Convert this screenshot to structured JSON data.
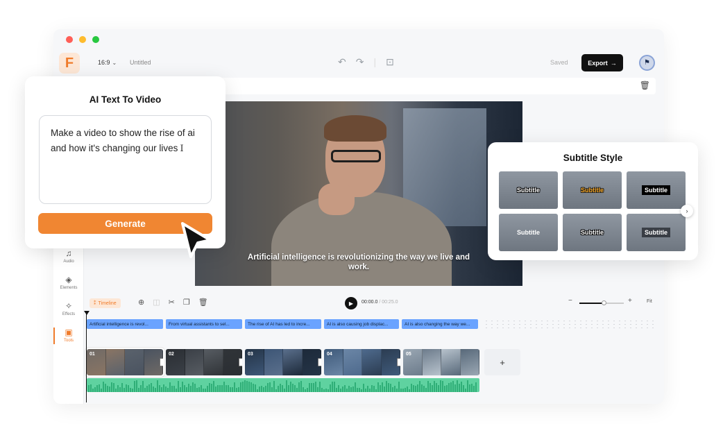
{
  "window": {
    "dot_colors": [
      "#ff5f57",
      "#febc2e",
      "#28c840"
    ]
  },
  "topbar": {
    "logo_letter": "F",
    "aspect_ratio": "16:9",
    "doc_title": "Untitled",
    "saved_label": "Saved",
    "export_label": "Export",
    "export_icon": "arrow-right-icon"
  },
  "sidebar": {
    "items": [
      {
        "label": "Audio",
        "icon": "music-note-icon"
      },
      {
        "label": "Elements",
        "icon": "shapes-icon"
      },
      {
        "label": "Effects",
        "icon": "sparkle-icon"
      },
      {
        "label": "Tools",
        "icon": "toolbox-icon",
        "active": true
      }
    ]
  },
  "video": {
    "caption": "Artificial intelligence is revolutionizing the way we live and work."
  },
  "timeline": {
    "tag_label": "Timeline",
    "current_time": "00:00.0",
    "total_time": "/ 00:25.0",
    "zoom_fit_label": "Fit",
    "subtitle_chips": [
      "Artificial intelligence is revol...",
      "From virtual assistants to sel...",
      "The rise of AI has led to incre...",
      "AI is also causing job displac...",
      "AI is also changing the way we..."
    ],
    "clips": [
      {
        "num": "01",
        "colors": [
          "#6f6a66",
          "#8a7564",
          "#5a626c",
          "#4a5360"
        ]
      },
      {
        "num": "02",
        "colors": [
          "#2a2e33",
          "#3b4047",
          "#575c62",
          "#303438"
        ]
      },
      {
        "num": "03",
        "colors": [
          "#243447",
          "#3d5676",
          "#5a6f8c",
          "#1d2a3a"
        ]
      },
      {
        "num": "04",
        "colors": [
          "#3f5a7a",
          "#6b86a6",
          "#4e6a8d",
          "#2c3d52"
        ]
      },
      {
        "num": "05",
        "colors": [
          "#9aa7b3",
          "#6d7c8c",
          "#b7c2cc",
          "#58697a"
        ]
      }
    ],
    "add_clip_label": "+"
  },
  "ai_card": {
    "title": "AI Text To Video",
    "prompt_text": "Make a video to show the rise of ai and how it's changing our lives",
    "generate_label": "Generate",
    "accent": "#f08632"
  },
  "subtitle_card": {
    "title": "Subtitle Style",
    "styles": [
      "Subtitle",
      "Subtitle",
      "Subtitle",
      "Subtitle",
      "Subtitle",
      "Subtitle"
    ]
  }
}
